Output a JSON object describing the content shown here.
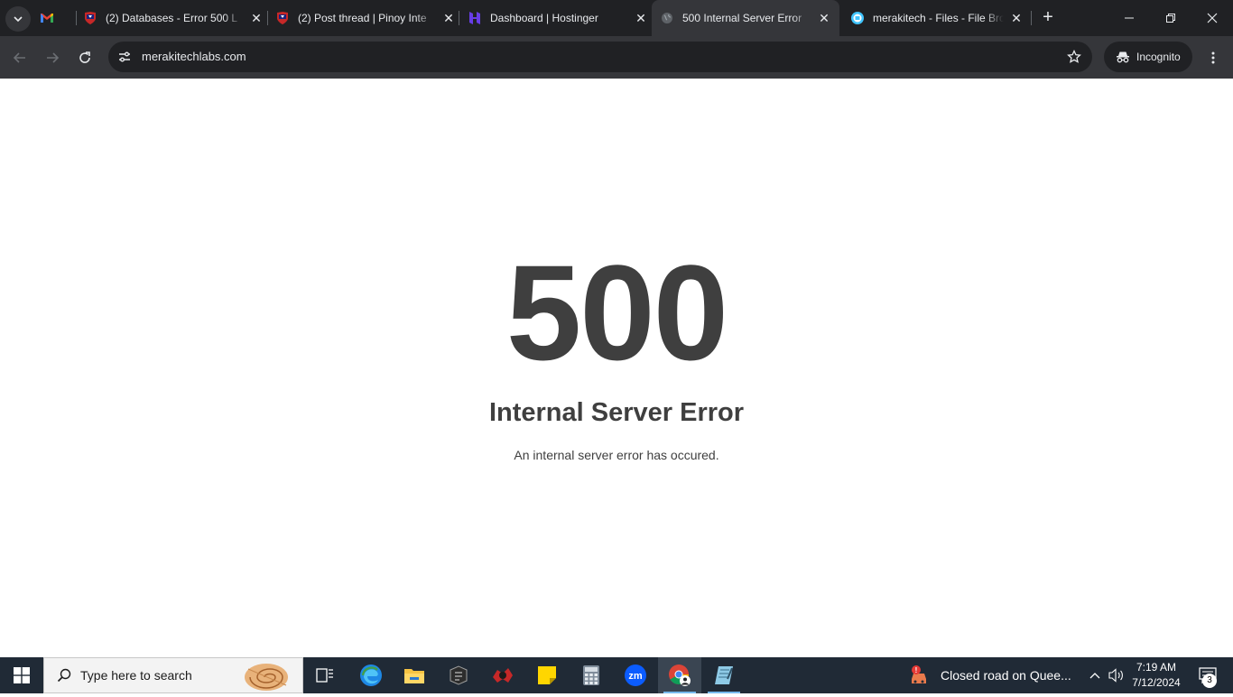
{
  "browser": {
    "tabs": [
      {
        "title": "",
        "favicon": "gmail-icon",
        "active": false
      },
      {
        "title": "(2) Databases - Error 500 L",
        "favicon": "forum-shield-icon",
        "active": false
      },
      {
        "title": "(2) Post thread | Pinoy Inte",
        "favicon": "forum-shield-icon",
        "active": false
      },
      {
        "title": "Dashboard | Hostinger",
        "favicon": "hostinger-icon",
        "active": false
      },
      {
        "title": "500 Internal Server Error",
        "favicon": "globe-icon",
        "active": true
      },
      {
        "title": "merakitech - Files - File Bro",
        "favicon": "filebrowser-icon",
        "active": false
      }
    ],
    "url": "merakitechlabs.com",
    "incognito_label": "Incognito"
  },
  "page": {
    "code": "500",
    "title": "Internal Server Error",
    "message": "An internal server error has occured."
  },
  "taskbar": {
    "search_placeholder": "Type here to search",
    "news_text": "Closed road on Quee...",
    "time": "7:19 AM",
    "date": "7/12/2024",
    "notification_count": "3"
  }
}
